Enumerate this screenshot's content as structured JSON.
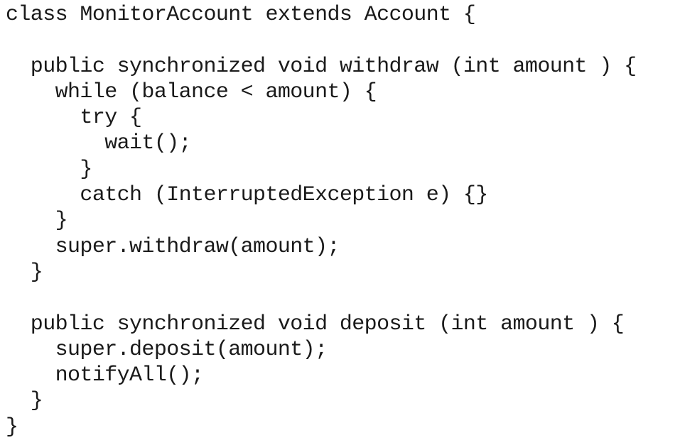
{
  "code": {
    "lines": [
      "class MonitorAccount extends Account {",
      "",
      "  public synchronized void withdraw (int amount ) {",
      "    while (balance < amount) {",
      "      try {",
      "        wait();",
      "      }",
      "      catch (InterruptedException e) {}",
      "    }",
      "    super.withdraw(amount);",
      "  }",
      "",
      "  public synchronized void deposit (int amount ) {",
      "    super.deposit(amount);",
      "    notifyAll();",
      "  }",
      "}"
    ]
  }
}
